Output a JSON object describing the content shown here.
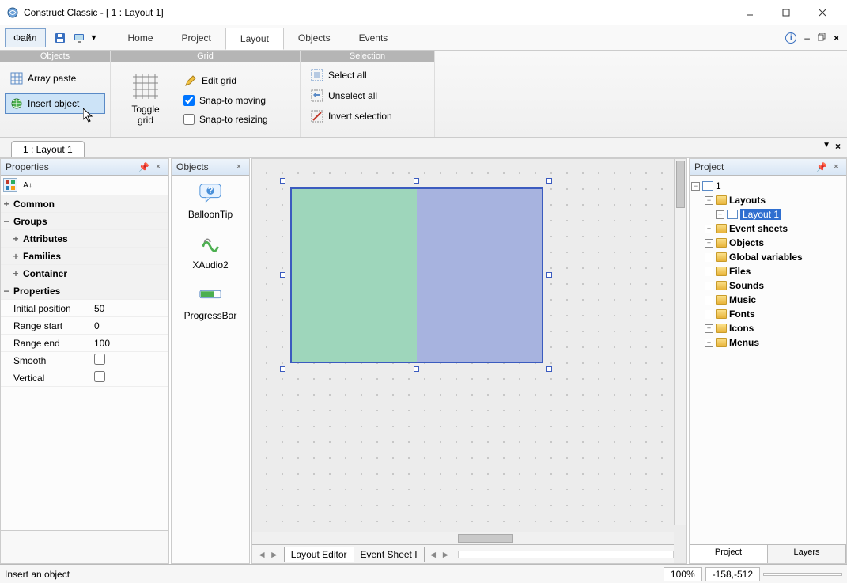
{
  "title": "Construct Classic - [ 1 : Layout 1]",
  "menubar": {
    "file": "Файл",
    "tabs": [
      "Home",
      "Project",
      "Layout",
      "Objects",
      "Events"
    ],
    "active_tab": 2
  },
  "ribbon": {
    "groups": {
      "objects": {
        "label": "Objects",
        "array_paste": "Array paste",
        "insert_object": "Insert object"
      },
      "grid": {
        "label": "Grid",
        "toggle_grid": "Toggle grid",
        "edit_grid": "Edit grid",
        "snap_moving": "Snap-to moving",
        "snap_resizing": "Snap-to resizing",
        "snap_moving_checked": true,
        "snap_resizing_checked": false
      },
      "selection": {
        "label": "Selection",
        "select_all": "Select all",
        "unselect_all": "Unselect all",
        "invert": "Invert selection"
      }
    }
  },
  "doctab": "1 : Layout 1",
  "panels": {
    "properties": {
      "title": "Properties",
      "cats": {
        "common": "Common",
        "groups": "Groups",
        "attributes": "Attributes",
        "families": "Families",
        "container": "Container",
        "properties": "Properties"
      },
      "rows": {
        "initial_position": {
          "k": "Initial position",
          "v": "50"
        },
        "range_start": {
          "k": "Range start",
          "v": "0"
        },
        "range_end": {
          "k": "Range end",
          "v": "100"
        },
        "smooth": {
          "k": "Smooth",
          "v": false
        },
        "vertical": {
          "k": "Vertical",
          "v": false
        }
      }
    },
    "objects": {
      "title": "Objects",
      "items": [
        "BalloonTip",
        "XAudio2",
        "ProgressBar"
      ]
    },
    "project": {
      "title": "Project",
      "root": "1",
      "nodes": {
        "layouts": "Layouts",
        "layout1": "Layout 1",
        "event_sheets": "Event sheets",
        "objects": "Objects",
        "globals": "Global variables",
        "files": "Files",
        "sounds": "Sounds",
        "music": "Music",
        "fonts": "Fonts",
        "icons": "Icons",
        "menus": "Menus"
      },
      "tabs": [
        "Project",
        "Layers"
      ],
      "active_tab": 0
    }
  },
  "canvas_tabs": {
    "layout_editor": "Layout Editor",
    "event_sheet": "Event Sheet I"
  },
  "status": {
    "hint": "Insert an object",
    "zoom": "100%",
    "coords": "-158,-512"
  }
}
